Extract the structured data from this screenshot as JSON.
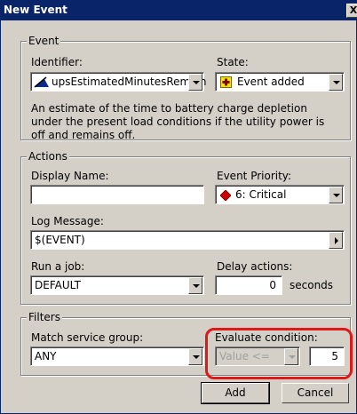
{
  "window": {
    "title": "New Event",
    "close_glyph": "X"
  },
  "event_group": {
    "legend": "Event",
    "identifier_label": "Identifier:",
    "identifier_value": "upsEstimatedMinutesRemain",
    "state_label": "State:",
    "state_value": "Event added",
    "description": "An estimate of the time to battery charge depletion under the present load conditions if the utility power is off and remains off."
  },
  "actions_group": {
    "legend": "Actions",
    "display_name_label": "Display Name:",
    "display_name_value": "",
    "priority_label": "Event Priority:",
    "priority_value": "6: Critical",
    "log_message_label": "Log Message:",
    "log_message_value": "$(EVENT)",
    "run_job_label": "Run a job:",
    "run_job_value": "DEFAULT",
    "delay_label": "Delay actions:",
    "delay_value": "0",
    "delay_unit": "seconds"
  },
  "filters_group": {
    "legend": "Filters",
    "match_label": "Match service group:",
    "match_value": "ANY",
    "evaluate_label": "Evaluate condition:",
    "evaluate_operator": "Value <=",
    "evaluate_value": "5"
  },
  "buttons": {
    "add": "Add",
    "cancel": "Cancel"
  },
  "colors": {
    "titlebar": "#0a246a",
    "highlight": "#e01818",
    "dialog_bg": "#d4d0c8"
  }
}
